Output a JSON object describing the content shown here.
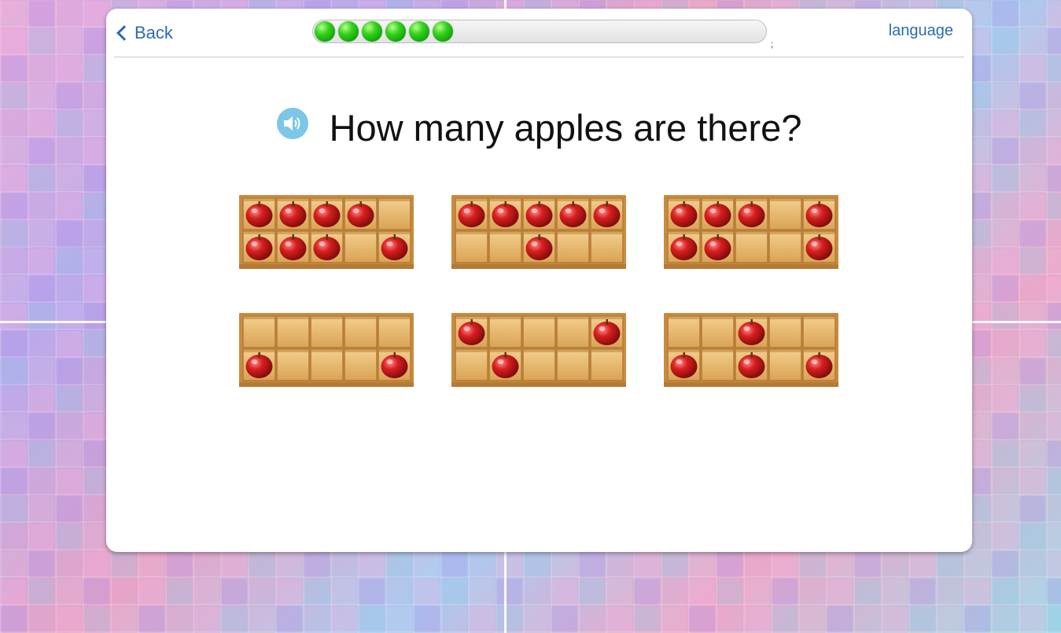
{
  "header": {
    "back_label": "Back",
    "language_label": "language",
    "progress_completed": 6,
    "progress_marker": ";"
  },
  "question": {
    "text": "How many apples are there?"
  },
  "choices": [
    {
      "cells": [
        1,
        1,
        1,
        1,
        0,
        1,
        1,
        1,
        0,
        1
      ]
    },
    {
      "cells": [
        1,
        1,
        1,
        1,
        1,
        0,
        0,
        1,
        0,
        0
      ]
    },
    {
      "cells": [
        1,
        1,
        1,
        0,
        1,
        1,
        1,
        0,
        0,
        1
      ]
    },
    {
      "cells": [
        0,
        0,
        0,
        0,
        0,
        1,
        0,
        0,
        0,
        1
      ]
    },
    {
      "cells": [
        1,
        0,
        0,
        0,
        1,
        0,
        1,
        0,
        0,
        0
      ]
    },
    {
      "cells": [
        0,
        0,
        1,
        0,
        0,
        1,
        0,
        1,
        0,
        1
      ]
    }
  ],
  "colors": {
    "link": "#2b6cb0",
    "speaker": "#7cc6e8",
    "wood": "#e2b56a",
    "apple": "#c81717",
    "progress": "#22c414"
  }
}
